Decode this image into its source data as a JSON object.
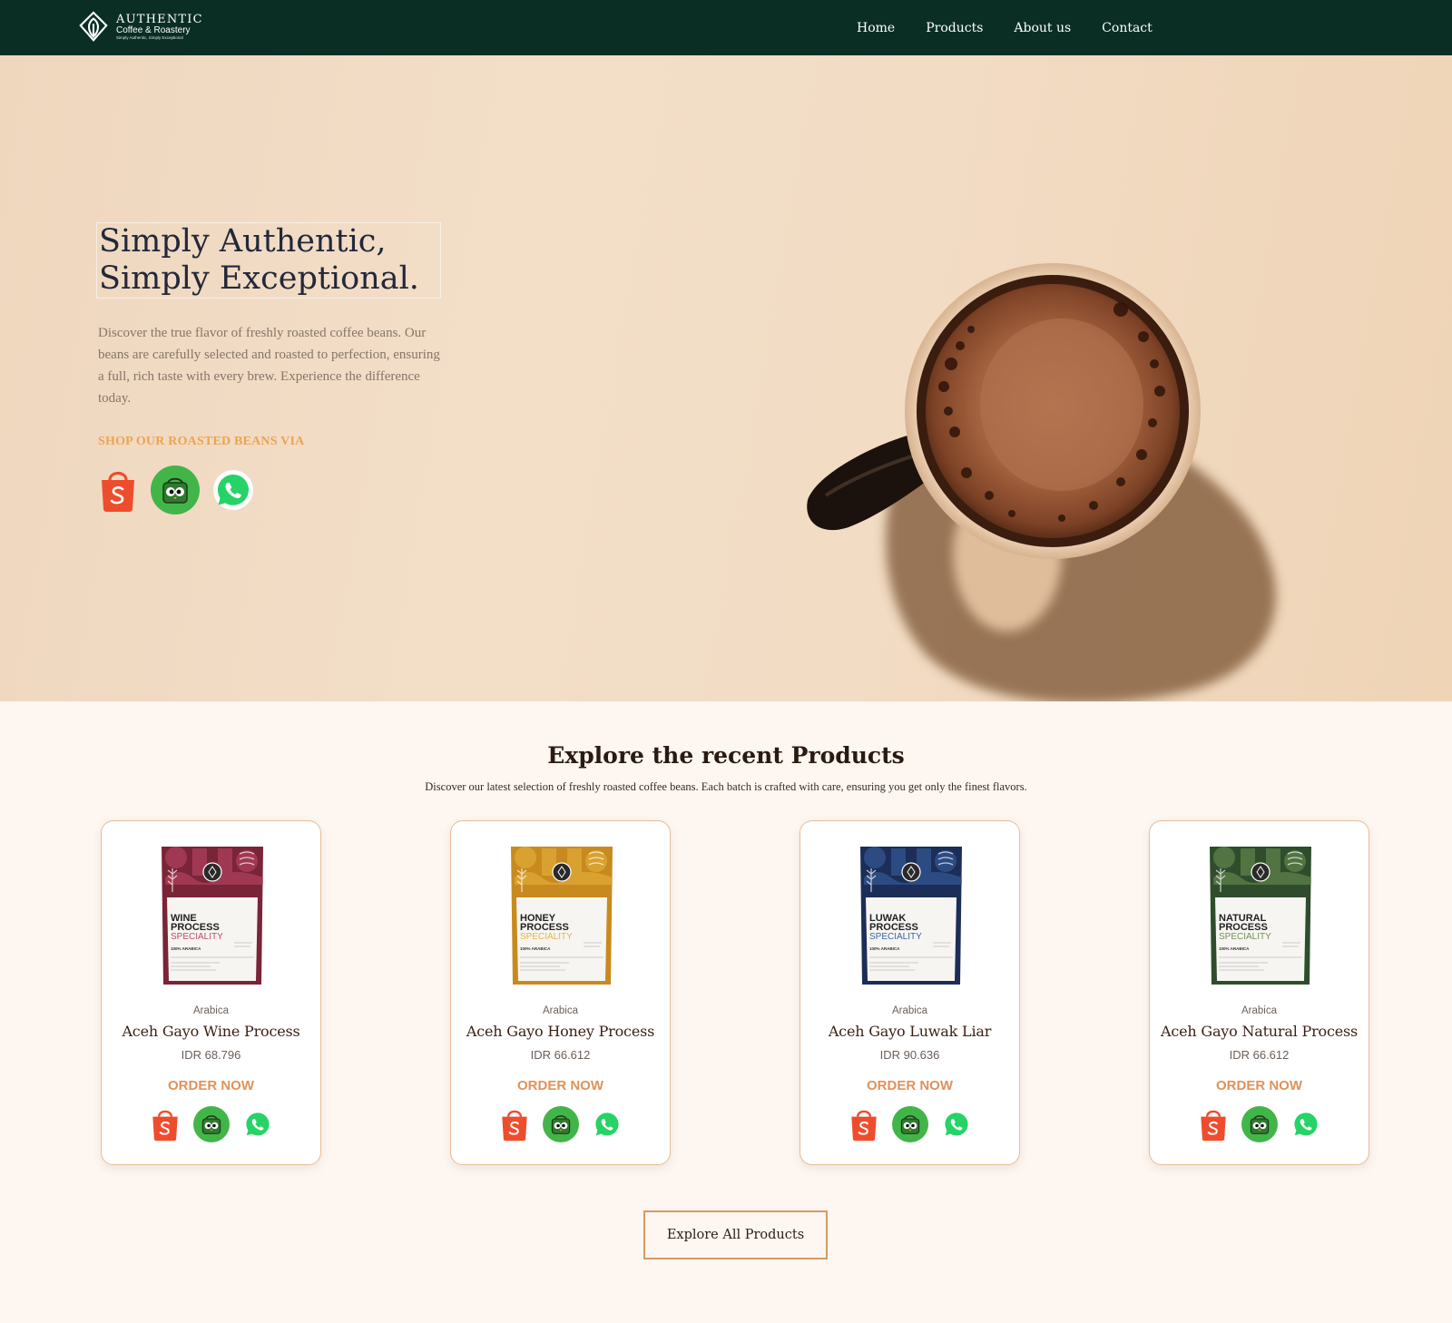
{
  "brand": {
    "name": "AUTHENTIC",
    "subtitle": "Coffee & Roastery",
    "tagline": "Simply Authentic, Simply Exceptional",
    "logo_icon": "leaf-diamond-icon"
  },
  "nav": {
    "items": [
      {
        "label": "Home"
      },
      {
        "label": "Products"
      },
      {
        "label": "About us"
      },
      {
        "label": "Contact"
      }
    ]
  },
  "hero": {
    "title_line1": "Simply Authentic,",
    "title_line2": "Simply Exceptional.",
    "description": "Discover the true flavor of freshly roasted coffee beans. Our beans are carefully selected and roasted to perfection, ensuring a full, rich taste with every brew. Experience the difference today.",
    "shop_label": "SHOP OUR ROASTED BEANS VIA",
    "image": "coffee-mug-photo",
    "shop_icons": [
      "shopee-icon",
      "tokopedia-icon",
      "whatsapp-icon"
    ]
  },
  "products_section": {
    "title": "Explore the recent Products",
    "subtitle": "Discover our latest selection of freshly roasted coffee beans. Each batch is crafted with care, ensuring you get only the finest flavors.",
    "cards": [
      {
        "type": "Arabica",
        "name": "Aceh Gayo Wine Process",
        "price": "IDR 68.796",
        "order_label": "ORDER NOW",
        "bag_line1": "WINE",
        "bag_line2": "PROCESS",
        "bag_line3": "SPECIALITY",
        "bag_line4": "100% ARABICA",
        "bag_color": "#7a2437",
        "bag_accent": "#c04a6a"
      },
      {
        "type": "Arabica",
        "name": "Aceh Gayo Honey Process",
        "price": "IDR 66.612",
        "order_label": "ORDER NOW",
        "bag_line1": "HONEY",
        "bag_line2": "PROCESS",
        "bag_line3": "SPECIALITY",
        "bag_line4": "100% ARABICA",
        "bag_color": "#c88a1e",
        "bag_accent": "#e7b540"
      },
      {
        "type": "Arabica",
        "name": "Aceh Gayo Luwak Liar",
        "price": "IDR 90.636",
        "order_label": "ORDER NOW",
        "bag_line1": "LUWAK",
        "bag_line2": "PROCESS",
        "bag_line3": "SPECIALITY",
        "bag_line4": "100% ARABICA",
        "bag_color": "#1c2e57",
        "bag_accent": "#3a63a6"
      },
      {
        "type": "Arabica",
        "name": "Aceh Gayo Natural Process",
        "price": "IDR 66.612",
        "order_label": "ORDER NOW",
        "bag_line1": "NATURAL",
        "bag_line2": "PROCESS",
        "bag_line3": "SPECIALITY",
        "bag_line4": "100% ARABICA",
        "bag_color": "#2f4d2c",
        "bag_accent": "#6f9254"
      }
    ]
  },
  "explore_button": {
    "label": "Explore All Products"
  },
  "colors": {
    "nav_bg": "#0a2e24",
    "accent_orange": "#e0925a",
    "shop_label": "#eba452",
    "card_border": "#e6bd98",
    "shopee": "#ee4d2d",
    "tokopedia": "#42b549",
    "whatsapp": "#25d366"
  }
}
